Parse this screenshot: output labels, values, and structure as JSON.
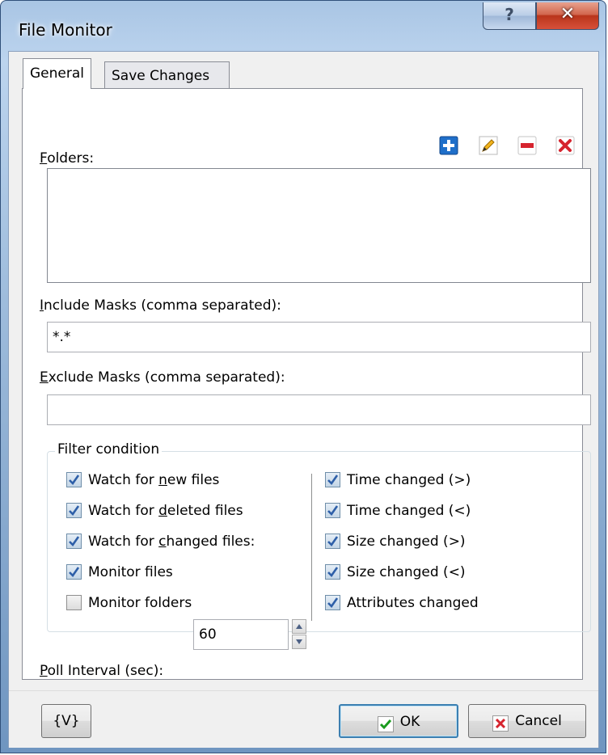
{
  "window": {
    "title": "File Monitor",
    "help_label": "?",
    "close_label": "✕"
  },
  "tabs": [
    {
      "label": "General",
      "active": true
    },
    {
      "label": "Save Changes",
      "active": false
    }
  ],
  "folders": {
    "label_key": "F",
    "label_rest": "olders:",
    "toolbar_icons": [
      "add-icon",
      "edit-icon",
      "remove-icon",
      "delete-icon"
    ],
    "items": []
  },
  "include_masks": {
    "label_key": "I",
    "label_rest": "nclude Masks (comma separated):",
    "value": "*.*"
  },
  "exclude_masks": {
    "label_key": "E",
    "label_rest": "xclude Masks (comma separated):",
    "value": ""
  },
  "filter": {
    "legend": "Filter condition",
    "left": [
      {
        "pre": "Watch for ",
        "key": "n",
        "post": "ew files",
        "checked": true
      },
      {
        "pre": "Watch for ",
        "key": "d",
        "post": "eleted files",
        "checked": true
      },
      {
        "pre": "Watch for ",
        "key": "c",
        "post": "hanged files:",
        "checked": true
      },
      {
        "pre": "Monitor files",
        "key": "",
        "post": "",
        "checked": true
      },
      {
        "pre": "Monitor folders",
        "key": "",
        "post": "",
        "checked": false
      }
    ],
    "right": [
      {
        "text": "Time changed (>)",
        "checked": true
      },
      {
        "text": "Time changed (<)",
        "checked": true
      },
      {
        "text": "Size changed (>)",
        "checked": true
      },
      {
        "text": "Size changed (<)",
        "checked": true
      },
      {
        "text": "Attributes changed",
        "checked": true
      }
    ]
  },
  "poll": {
    "label_key": "P",
    "label_rest": "oll Interval (sec):",
    "value": "60"
  },
  "buttons": {
    "variables": "{V}",
    "ok": "OK",
    "cancel": "Cancel"
  },
  "colors": {
    "check_blue": "#2e5fa8",
    "add_blue": "#1f6fc9",
    "remove_red": "#d6242e"
  }
}
